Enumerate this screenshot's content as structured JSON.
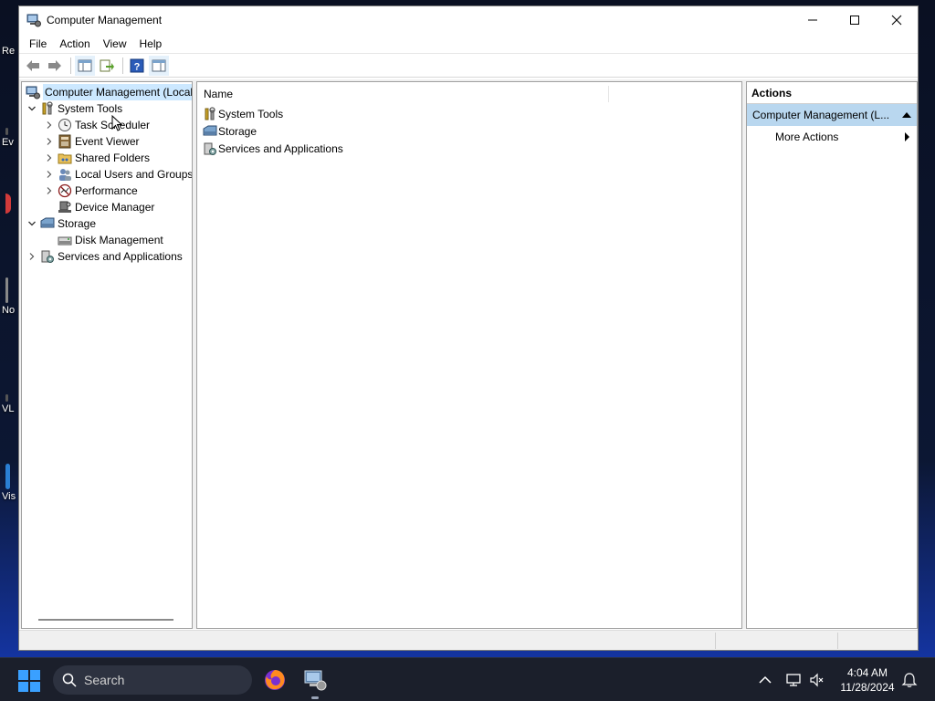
{
  "desktop": {
    "icons": [
      {
        "label": "Re",
        "color": "#2a2a2a"
      },
      {
        "label": "Ev",
        "color": "#555555"
      },
      {
        "label": "",
        "color": "#d23a3a"
      },
      {
        "label": "No",
        "color": "#666666"
      },
      {
        "label": "VL",
        "color": "#444444"
      },
      {
        "label": "Vis",
        "color": "#2a7fd4"
      }
    ]
  },
  "window": {
    "title": "Computer Management",
    "controls": {
      "minimize_icon": "minimize-icon",
      "maximize_icon": "maximize-icon",
      "close_icon": "close-icon"
    }
  },
  "menubar": {
    "items": [
      "File",
      "Action",
      "View",
      "Help"
    ]
  },
  "toolbar": {
    "icons": [
      "back-arrow-icon",
      "forward-arrow-icon",
      "show-hide-console-tree-icon",
      "export-list-icon",
      "help-icon",
      "show-hide-action-pane-icon"
    ]
  },
  "tree": {
    "root": "Computer Management (Local",
    "items": [
      {
        "label": "System Tools",
        "expanded": true
      },
      {
        "label": "Task Scheduler"
      },
      {
        "label": "Event Viewer"
      },
      {
        "label": "Shared Folders"
      },
      {
        "label": "Local Users and Groups"
      },
      {
        "label": "Performance"
      },
      {
        "label": "Device Manager"
      },
      {
        "label": "Storage",
        "expanded": true
      },
      {
        "label": "Disk Management"
      },
      {
        "label": "Services and Applications"
      }
    ]
  },
  "list": {
    "column_header": "Name",
    "rows": [
      "System Tools",
      "Storage",
      "Services and Applications"
    ]
  },
  "actions": {
    "header": "Actions",
    "section": "Computer Management (L...",
    "more_actions": "More Actions"
  },
  "taskbar": {
    "search_label": "Search",
    "clock_time": "4:04 AM",
    "clock_date": "11/28/2024"
  },
  "colors": {
    "selection": "#cce8ff",
    "actions_section": "#b9d7ef",
    "taskbar": "#1b1f2b",
    "windows_blue": "#0078d4"
  }
}
